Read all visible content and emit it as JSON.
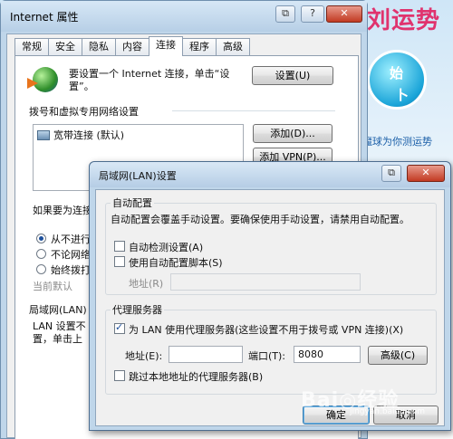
{
  "background": {
    "promo_text": "刘运势",
    "promo_circle": [
      "始",
      "卜"
    ],
    "promo_caption": "魔球为你测运势"
  },
  "properties_window": {
    "title": "Internet 属性",
    "buttons": {
      "help": "?",
      "close": "✕"
    },
    "tabs": [
      {
        "label": "常规"
      },
      {
        "label": "安全"
      },
      {
        "label": "隐私"
      },
      {
        "label": "内容"
      },
      {
        "label": "连接",
        "active": true
      },
      {
        "label": "程序"
      },
      {
        "label": "高级"
      }
    ],
    "setup_text": "要设置一个 Internet 连接，单击“设置”。",
    "setup_button": "设置(U)",
    "dialup_section": "拨号和虚拟专用网络设置",
    "connections": [
      {
        "label": "宽带连接 (默认)"
      }
    ],
    "add_button": "添加(D)...",
    "add_vpn_button": "添加 VPN(P)...",
    "dial_prompt": "如果要为连接",
    "radios": [
      {
        "label": "从不进行",
        "selected": true
      },
      {
        "label": "不论网络",
        "selected": false
      },
      {
        "label": "始终拨打",
        "selected": false
      }
    ],
    "current_default": "当前默认",
    "lan_section": "局域网(LAN)",
    "lan_desc_1": "LAN 设置不",
    "lan_desc_2": "置，单击上"
  },
  "lan_dialog": {
    "title": "局域网(LAN)设置",
    "auto_group": "自动配置",
    "auto_desc": "自动配置会覆盖手动设置。要确保使用手动设置，请禁用自动配置。",
    "auto_detect": {
      "label": "自动检测设置(A)",
      "checked": false
    },
    "auto_script": {
      "label": "使用自动配置脚本(S)",
      "checked": false
    },
    "address_label": "地址(R)",
    "proxy_group": "代理服务器",
    "use_proxy": {
      "label": "为 LAN 使用代理服务器(这些设置不用于拨号或 VPN 连接)(X)",
      "checked": true
    },
    "proxy_address_label": "地址(E):",
    "proxy_address_value": "",
    "port_label": "端口(T):",
    "port_value": "8080",
    "advanced_button": "高级(C)",
    "bypass_local": {
      "label": "跳过本地地址的代理服务器(B)",
      "checked": false
    },
    "ok_button": "确定",
    "cancel_button": "取消"
  },
  "watermark": {
    "text": "Bai◎经验",
    "sub": "jingyan.baidu.com"
  }
}
